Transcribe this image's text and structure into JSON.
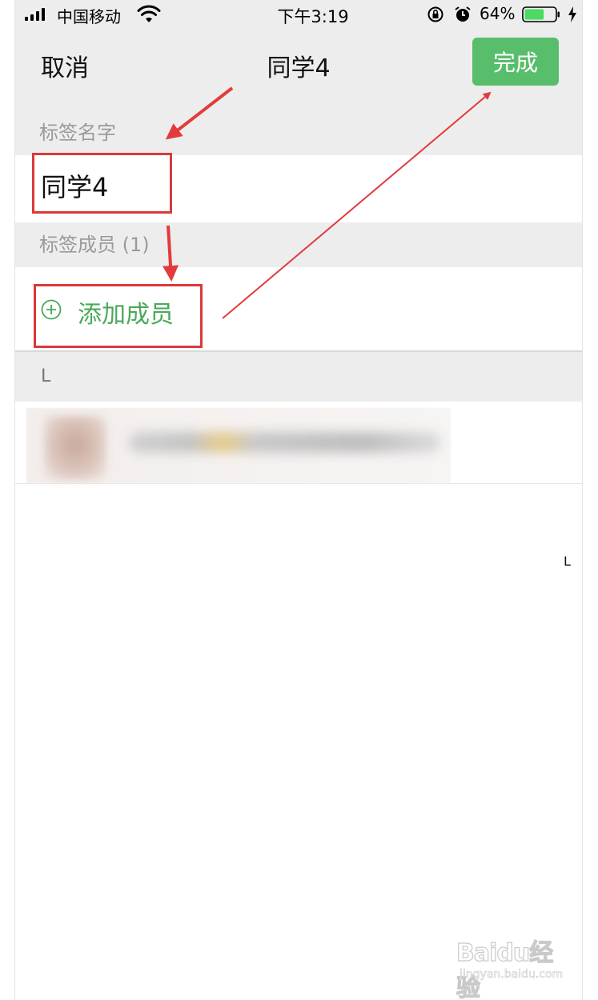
{
  "status_bar": {
    "carrier": "中国移动",
    "time": "下午3:19",
    "battery_percent": "64%",
    "battery_level": 0.64,
    "icons": [
      "signal-icon",
      "wifi-icon",
      "rotation-lock-icon",
      "alarm-icon",
      "battery-icon",
      "charging-icon"
    ]
  },
  "nav": {
    "cancel_label": "取消",
    "title": "同学4",
    "done_label": "完成"
  },
  "form": {
    "name_section_label": "标签名字",
    "name_value": "同学4",
    "members_section_label": "标签成员 (1)",
    "add_member_label": "添加成员",
    "add_icon": "plus-circle-icon"
  },
  "members": {
    "index_header": "L",
    "side_index": "L",
    "items": [
      {
        "avatar": "blurred",
        "name": "blurred"
      }
    ]
  },
  "colors": {
    "accent_green": "#58be6b",
    "add_text_green": "#4aa95a",
    "annotation_red": "#d93a3a",
    "section_gray": "#ededed"
  },
  "watermark": {
    "logo": "Baidu经验",
    "url": "jingyan.baidu.com"
  }
}
